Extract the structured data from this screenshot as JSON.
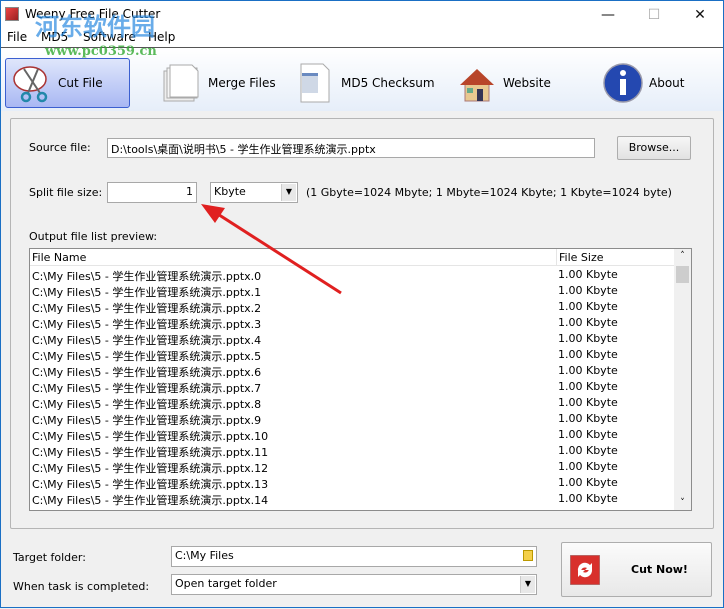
{
  "window": {
    "title": "Weeny Free File Cutter",
    "minimize": "—",
    "maximize": "☐",
    "close": "✕"
  },
  "watermark": {
    "text": "河东软件园",
    "url": "www.pc0359.cn"
  },
  "menu": [
    "File",
    "MD5",
    "Software",
    "Help"
  ],
  "toolbar": [
    {
      "label": "Cut File",
      "icon": "scissors-icon"
    },
    {
      "label": "Merge Files",
      "icon": "pages-icon"
    },
    {
      "label": "MD5 Checksum",
      "icon": "binary-document-icon"
    },
    {
      "label": "Website",
      "icon": "house-icon"
    },
    {
      "label": "About",
      "icon": "info-icon"
    }
  ],
  "source": {
    "label": "Source file:",
    "value": "D:\\tools\\桌面\\说明书\\5 - 学生作业管理系统演示.pptx",
    "browse": "Browse..."
  },
  "split": {
    "label": "Split file size:",
    "value": "1",
    "unit": "Kbyte",
    "note": "(1 Gbyte=1024 Mbyte; 1 Mbyte=1024 Kbyte; 1 Kbyte=1024 byte)"
  },
  "preview": {
    "label": "Output file list preview:",
    "col_name": "File Name",
    "col_size": "File Size",
    "rows": [
      [
        "C:\\My Files\\5 - 学生作业管理系统演示.pptx.0",
        "1.00 Kbyte"
      ],
      [
        "C:\\My Files\\5 - 学生作业管理系统演示.pptx.1",
        "1.00 Kbyte"
      ],
      [
        "C:\\My Files\\5 - 学生作业管理系统演示.pptx.2",
        "1.00 Kbyte"
      ],
      [
        "C:\\My Files\\5 - 学生作业管理系统演示.pptx.3",
        "1.00 Kbyte"
      ],
      [
        "C:\\My Files\\5 - 学生作业管理系统演示.pptx.4",
        "1.00 Kbyte"
      ],
      [
        "C:\\My Files\\5 - 学生作业管理系统演示.pptx.5",
        "1.00 Kbyte"
      ],
      [
        "C:\\My Files\\5 - 学生作业管理系统演示.pptx.6",
        "1.00 Kbyte"
      ],
      [
        "C:\\My Files\\5 - 学生作业管理系统演示.pptx.7",
        "1.00 Kbyte"
      ],
      [
        "C:\\My Files\\5 - 学生作业管理系统演示.pptx.8",
        "1.00 Kbyte"
      ],
      [
        "C:\\My Files\\5 - 学生作业管理系统演示.pptx.9",
        "1.00 Kbyte"
      ],
      [
        "C:\\My Files\\5 - 学生作业管理系统演示.pptx.10",
        "1.00 Kbyte"
      ],
      [
        "C:\\My Files\\5 - 学生作业管理系统演示.pptx.11",
        "1.00 Kbyte"
      ],
      [
        "C:\\My Files\\5 - 学生作业管理系统演示.pptx.12",
        "1.00 Kbyte"
      ],
      [
        "C:\\My Files\\5 - 学生作业管理系统演示.pptx.13",
        "1.00 Kbyte"
      ],
      [
        "C:\\My Files\\5 - 学生作业管理系统演示.pptx.14",
        "1.00 Kbyte"
      ]
    ]
  },
  "target": {
    "label": "Target folder:",
    "value": "C:\\My Files"
  },
  "when_done": {
    "label": "When task is completed:",
    "value": "Open target folder"
  },
  "cut_now": "Cut Now!",
  "colors": {
    "accent": "#3b5fd0",
    "arrow": "#e02020"
  }
}
